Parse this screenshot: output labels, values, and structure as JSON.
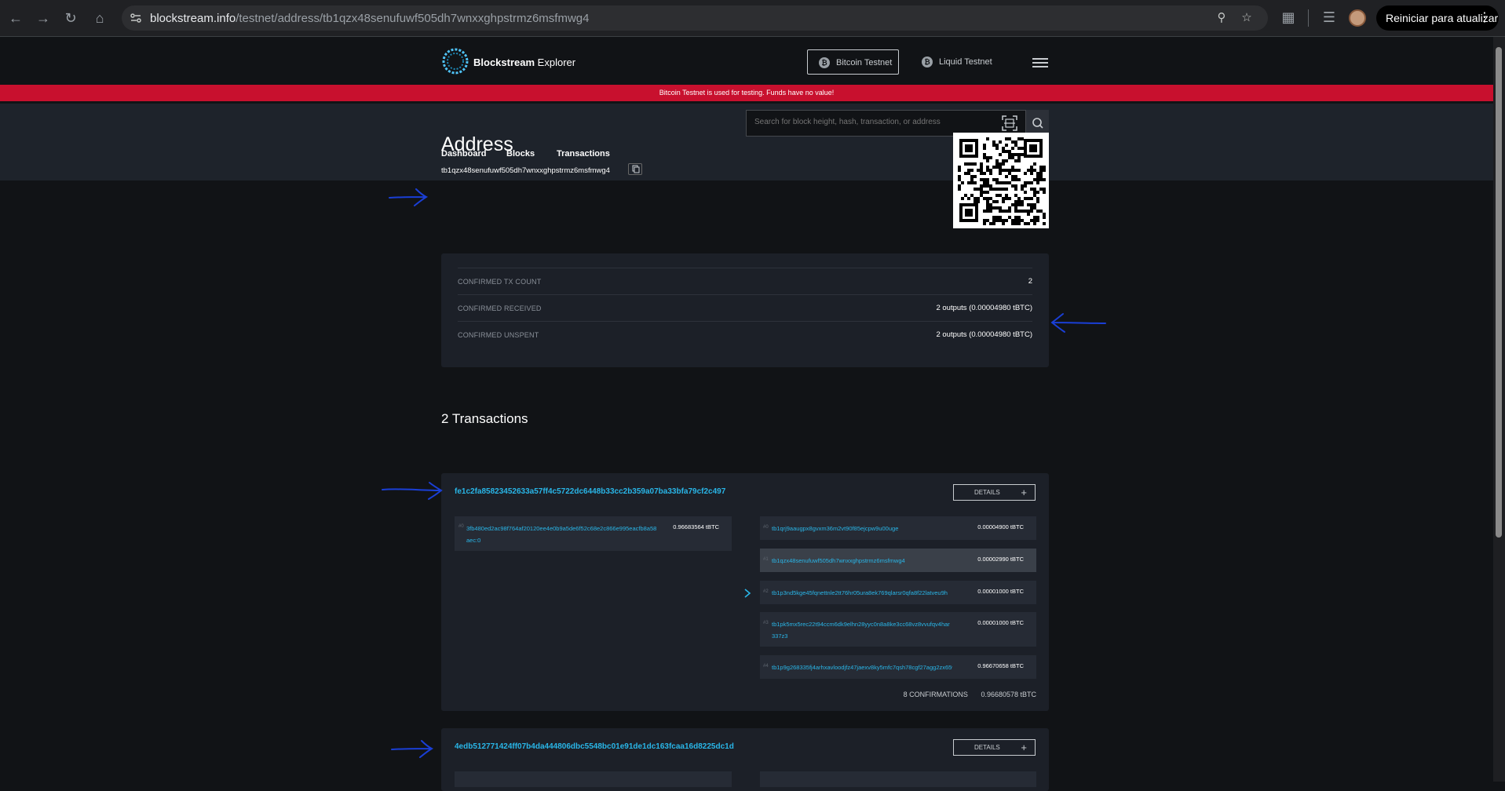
{
  "browser": {
    "url_host": "blockstream.info",
    "url_path": "/testnet/address/tb1qzx48senufuwf505dh7wnxxghpstrmz6msfmwg4",
    "restart_label": "Reiniciar para atualizar"
  },
  "header": {
    "logo_bold": "Blockstream",
    "logo_light": "Explorer",
    "networks": [
      {
        "label": "Bitcoin Testnet",
        "active": true
      },
      {
        "label": "Liquid Testnet",
        "active": false
      }
    ]
  },
  "banner": "Bitcoin Testnet is used for testing. Funds have no value!",
  "nav": {
    "items": [
      "Dashboard",
      "Blocks",
      "Transactions"
    ],
    "search_placeholder": "Search for block height, hash, transaction, or address"
  },
  "address": {
    "title": "Address",
    "value": "tb1qzx48senufuwf505dh7wnxxghpstrmz6msfmwg4"
  },
  "stats": [
    {
      "label": "CONFIRMED TX COUNT",
      "value": "2"
    },
    {
      "label": "CONFIRMED RECEIVED",
      "value": "2 outputs (0.00004980 tBTC)"
    },
    {
      "label": "CONFIRMED UNSPENT",
      "value": "2 outputs (0.00004980 tBTC)"
    }
  ],
  "transactions_heading": "2 Transactions",
  "transactions": [
    {
      "hash": "fe1c2fa85823452633a57ff4c5722dc6448b33cc2b359a07ba33bfa79cf2c497",
      "details_label": "DETAILS",
      "input": {
        "index": "#0",
        "address": "3fb480ed2ac98f764af20120ee4e0b9a5de6f52c68e2c866e995eacfb8a58aec:0",
        "amount": "0.96683564 tBTC"
      },
      "outputs": [
        {
          "index": "#0",
          "address": "tb1qrj9aaugpx8gvxm36m2vt90f85ejcpw9u00uge",
          "amount": "0.00004900 tBTC"
        },
        {
          "index": "#1",
          "address": "tb1qzx48senufuwf505dh7wnxxghpstrmz6msfmwg4",
          "amount": "0.00002990 tBTC"
        },
        {
          "index": "#2",
          "address": "tb1p3nd5kge45fqnettnle2tt76hr05ura8ek769qlarsr0qfa8f22latveu9h",
          "amount": "0.00001000 tBTC"
        },
        {
          "index": "#3",
          "address": "tb1pk5mx5rec22t94ccm6dk9elhn28yyc0n8a8ke3cc68vz8vvufqv4har337z3",
          "amount": "0.00001000 tBTC"
        },
        {
          "index": "#4",
          "address": "tb1p9g268335fj4arhxavloodjfz47jaexv8ky5mfc7qsh78cgf27agg2zx65wze",
          "amount": "0.96670658 tBTC"
        }
      ],
      "confirmations": "8 CONFIRMATIONS",
      "total": "0.96680578 tBTC"
    },
    {
      "hash": "4edb512771424ff07b4da444806dbc5548bc01e91de1dc163fcaa16d8225dc1d",
      "details_label": "DETAILS"
    }
  ],
  "colors": {
    "accent": "#29b6e8",
    "banner": "#c8102e",
    "annotation": "#1a3fd6"
  }
}
